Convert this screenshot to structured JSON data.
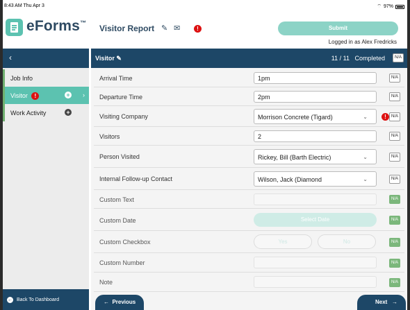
{
  "status": {
    "time": "8:43 AM  Thu Apr 3",
    "battery": "97%"
  },
  "header": {
    "logo": "eForms",
    "logo_tm": "™",
    "report_title": "Visitor Report",
    "submit_label": "Submit",
    "logged_in": "Logged in as Alex Fredricks",
    "edit_icon": "pencil-icon",
    "mail_icon": "envelope-icon"
  },
  "sidebar": {
    "back_glyph": "‹",
    "items": [
      {
        "label": "Job Info"
      },
      {
        "label": "Visitor"
      },
      {
        "label": "Work Activity"
      }
    ],
    "dashboard_label": "Back To Dashboard"
  },
  "main": {
    "title": "Visitor",
    "progress": "11 / 11",
    "status": "Completed",
    "na_label": "N/A",
    "fields": {
      "arrival": {
        "label": "Arrival Time",
        "value": "1pm"
      },
      "departure": {
        "label": "Departure Time",
        "value": "2pm"
      },
      "company": {
        "label": "Visiting Company",
        "value": "Morrison Concrete (Tigard)"
      },
      "visitors": {
        "label": "Visitors",
        "value": "2"
      },
      "person": {
        "label": "Person Visited",
        "value": "Rickey, Bill (Barth Electric)"
      },
      "followup": {
        "label": "Internal Follow-up Contact",
        "value": "Wilson, Jack (Diamond"
      },
      "custom_text": {
        "label": "Custom Text"
      },
      "custom_date": {
        "label": "Custom Date",
        "button": "Select Date"
      },
      "custom_checkbox": {
        "label": "Custom Checkbox",
        "yes": "Yes",
        "no": "No"
      },
      "custom_number": {
        "label": "Custom Number"
      },
      "note": {
        "label": "Note"
      }
    }
  },
  "footer": {
    "previous": "Previous",
    "next": "Next"
  },
  "colors": {
    "navy": "#1d4767",
    "teal": "#5cc2b0",
    "error": "#dd1111",
    "na_green": "#7bb77b"
  }
}
